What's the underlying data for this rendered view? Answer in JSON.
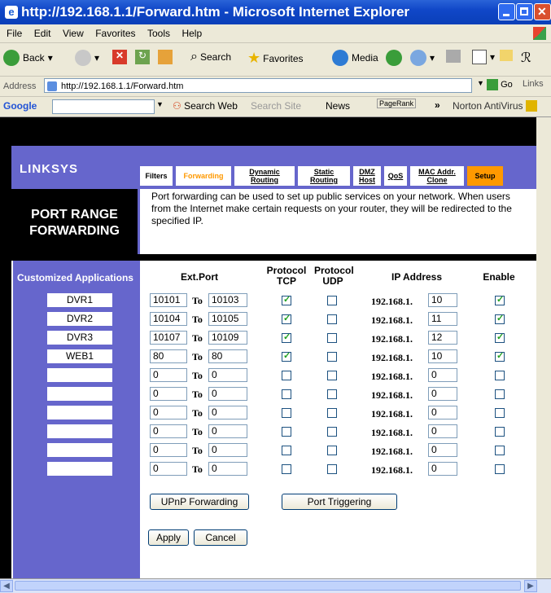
{
  "window": {
    "title": "http://192.168.1.1/Forward.htm - Microsoft Internet Explorer"
  },
  "menu": [
    "File",
    "Edit",
    "View",
    "Favorites",
    "Tools",
    "Help"
  ],
  "toolbar": {
    "back": "Back",
    "search": "Search",
    "favorites": "Favorites",
    "media": "Media"
  },
  "address": {
    "label": "Address",
    "url": "http://192.168.1.1/Forward.htm",
    "go": "Go",
    "links": "Links"
  },
  "google_bar": {
    "brand": "Google",
    "search_web": "Search Web",
    "search_site": "Search Site",
    "news": "News",
    "pagerank": "PageRank",
    "norton": "Norton AntiVirus"
  },
  "router": {
    "logo": "LINKSYS",
    "tabs": [
      {
        "label": "Filters"
      },
      {
        "label": "Forwarding"
      },
      {
        "label": "Dynamic Routing"
      },
      {
        "label": "Static Routing"
      },
      {
        "label": "DMZ Host"
      },
      {
        "label": "QoS"
      },
      {
        "label": "MAC Addr. Clone"
      },
      {
        "label": "Setup"
      }
    ],
    "section_title_1": "PORT RANGE",
    "section_title_2": "FORWARDING",
    "description": "Port forwarding can be used to set up public services on your network. When users from the Internet make certain requests on your router, they will be redirected to the specified IP.",
    "headers": {
      "apps": "Customized Applications",
      "ext_port": "Ext.Port",
      "tcp": "Protocol TCP",
      "udp": "Protocol UDP",
      "ip": "IP Address",
      "enable": "Enable"
    },
    "to_label": "To",
    "ip_prefix": "192.168.1.",
    "rows": [
      {
        "app": "DVR1",
        "start": "10101",
        "end": "10103",
        "tcp": true,
        "udp": false,
        "ip": "10",
        "enable": true
      },
      {
        "app": "DVR2",
        "start": "10104",
        "end": "10105",
        "tcp": true,
        "udp": false,
        "ip": "11",
        "enable": true
      },
      {
        "app": "DVR3",
        "start": "10107",
        "end": "10109",
        "tcp": true,
        "udp": false,
        "ip": "12",
        "enable": true
      },
      {
        "app": "WEB1",
        "start": "80",
        "end": "80",
        "tcp": true,
        "udp": false,
        "ip": "10",
        "enable": true
      },
      {
        "app": "",
        "start": "0",
        "end": "0",
        "tcp": false,
        "udp": false,
        "ip": "0",
        "enable": false
      },
      {
        "app": "",
        "start": "0",
        "end": "0",
        "tcp": false,
        "udp": false,
        "ip": "0",
        "enable": false
      },
      {
        "app": "",
        "start": "0",
        "end": "0",
        "tcp": false,
        "udp": false,
        "ip": "0",
        "enable": false
      },
      {
        "app": "",
        "start": "0",
        "end": "0",
        "tcp": false,
        "udp": false,
        "ip": "0",
        "enable": false
      },
      {
        "app": "",
        "start": "0",
        "end": "0",
        "tcp": false,
        "udp": false,
        "ip": "0",
        "enable": false
      },
      {
        "app": "",
        "start": "0",
        "end": "0",
        "tcp": false,
        "udp": false,
        "ip": "0",
        "enable": false
      }
    ],
    "buttons": {
      "upnp": "UPnP Forwarding",
      "triggering": "Port Triggering",
      "apply": "Apply",
      "cancel": "Cancel"
    }
  },
  "colors": {
    "router_panel": "#6666cc",
    "setup_tab": "#ff9900",
    "titlebar": "#1047c8"
  }
}
